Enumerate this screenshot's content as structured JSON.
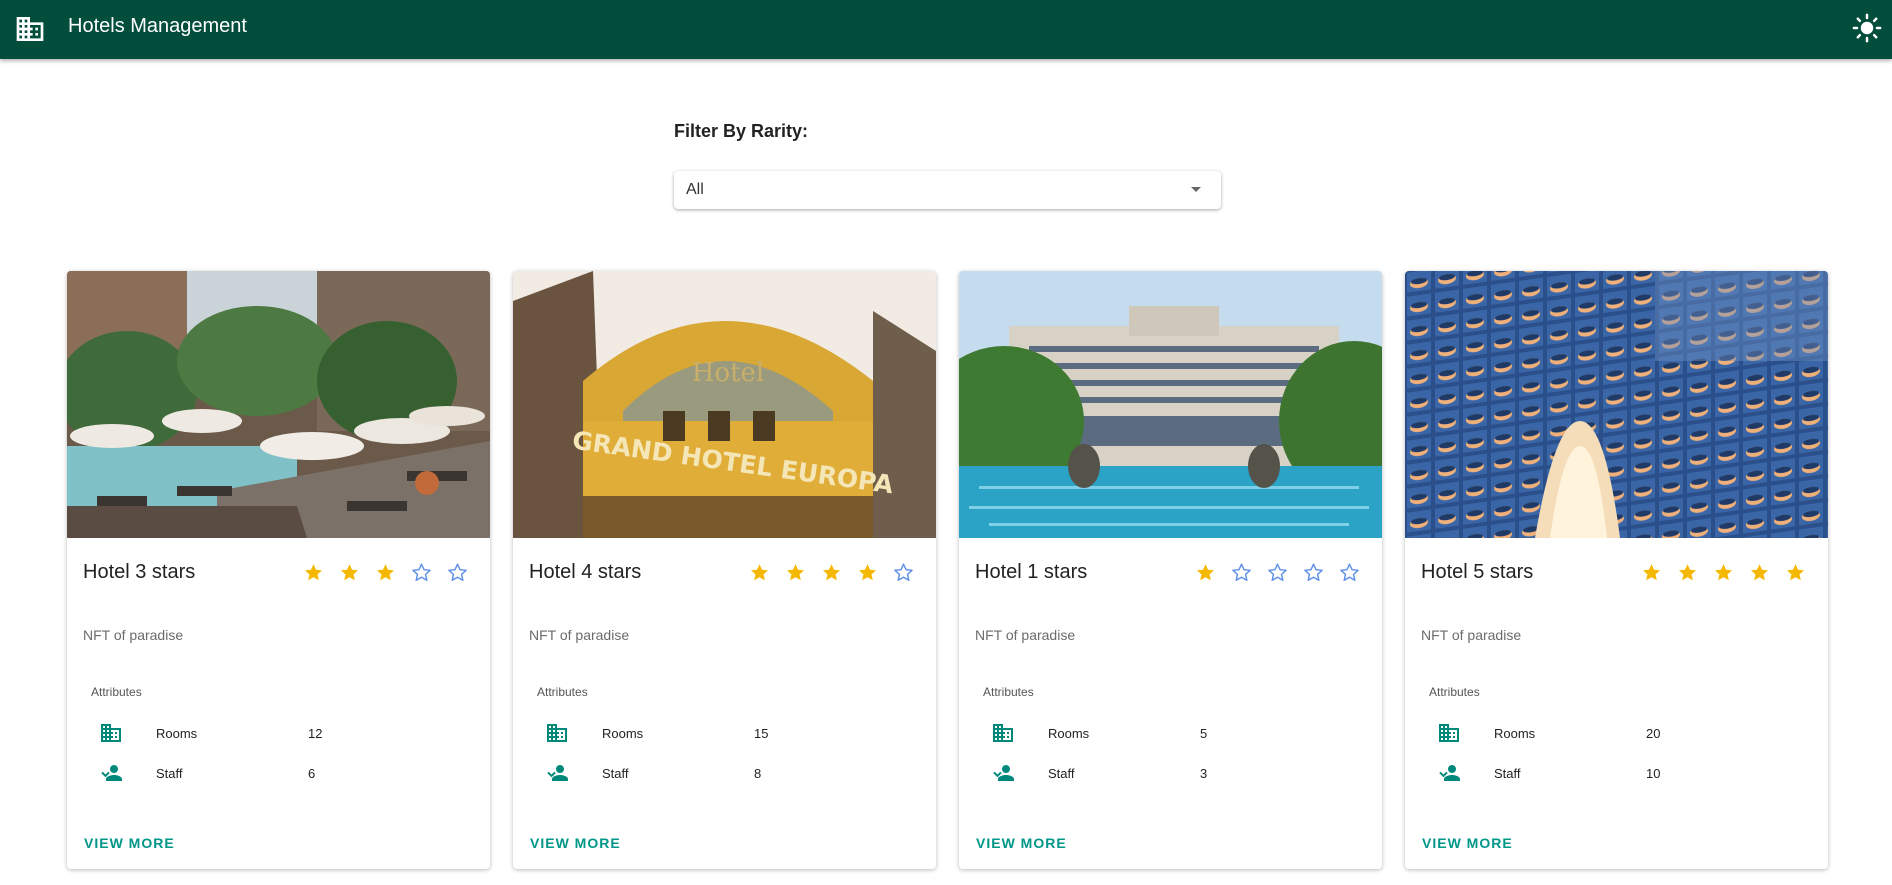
{
  "app": {
    "title": "Hotels Management",
    "logo_icon": "building-icon",
    "theme_icon": "sun-icon"
  },
  "filter": {
    "label": "Filter By Rarity:",
    "selected": "All"
  },
  "colors": {
    "appbar": "#034d3d",
    "accent": "#009688",
    "star_filled": "#f5b800",
    "star_empty": "#5b8ee6"
  },
  "cards": [
    {
      "name": "Hotel 3 stars",
      "rating": 3,
      "max_rating": 5,
      "description": "NFT of paradise",
      "attributes_title": "Attributes",
      "rooms_label": "Rooms",
      "rooms": "12",
      "staff_label": "Staff",
      "staff": "6",
      "action": "VIEW MORE"
    },
    {
      "name": "Hotel 4 stars",
      "rating": 4,
      "max_rating": 5,
      "description": "NFT of paradise",
      "attributes_title": "Attributes",
      "rooms_label": "Rooms",
      "rooms": "15",
      "staff_label": "Staff",
      "staff": "8",
      "action": "VIEW MORE",
      "photo_text_top": "Hotel",
      "photo_text_main": "GRAND HOTEL EUROPA"
    },
    {
      "name": "Hotel 1 stars",
      "rating": 1,
      "max_rating": 5,
      "description": "NFT of paradise",
      "attributes_title": "Attributes",
      "rooms_label": "Rooms",
      "rooms": "5",
      "staff_label": "Staff",
      "staff": "3",
      "action": "VIEW MORE"
    },
    {
      "name": "Hotel 5 stars",
      "rating": 5,
      "max_rating": 5,
      "description": "NFT of paradise",
      "attributes_title": "Attributes",
      "rooms_label": "Rooms",
      "rooms": "20",
      "staff_label": "Staff",
      "staff": "10",
      "action": "VIEW MORE"
    }
  ]
}
